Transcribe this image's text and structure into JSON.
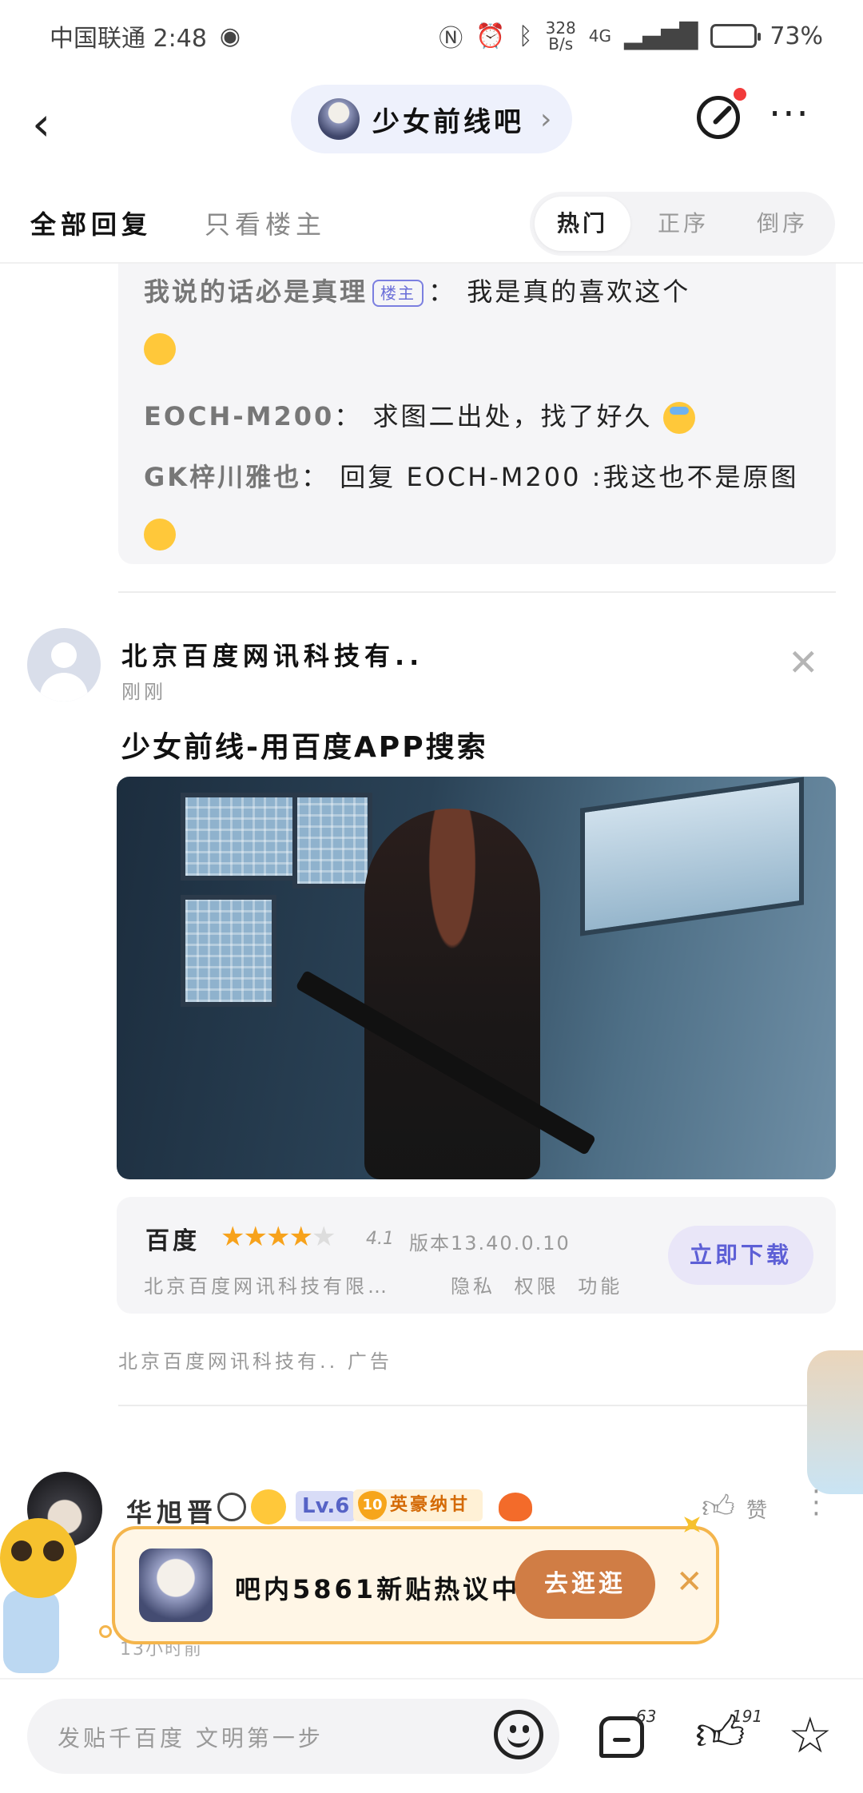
{
  "status_bar": {
    "carrier_time": "中国联通 2:48",
    "speed_value": "328",
    "speed_unit": "B/s",
    "network": "4G",
    "battery_percent": "73%",
    "battery_level": 0.73
  },
  "top_nav": {
    "forum_name": "少女前线吧"
  },
  "filter": {
    "tab_all": "全部回复",
    "tab_op_only": "只看楼主",
    "sort_hot": "热门",
    "sort_asc": "正序",
    "sort_desc": "倒序"
  },
  "sub_replies": [
    {
      "user": "我说的话必是真理",
      "tag": "楼主",
      "sep": "：",
      "text": "我是真的喜欢这个"
    },
    {
      "user": "EOCH-M200",
      "sep": "：",
      "text": "求图二出处，找了好久"
    },
    {
      "user": "GK梓川雅也",
      "sep": "：",
      "text": "回复 EOCH-M200 :我这也不是原图"
    }
  ],
  "ad": {
    "advertiser": "北京百度网讯科技有..",
    "time": "刚刚",
    "title": "少女前线-用百度APP搜索",
    "app_name": "百度",
    "rating": "4.1",
    "rating_value": 4.1,
    "version": "版本13.40.0.10",
    "developer": "北京百度网讯科技有限…",
    "links": [
      "隐私",
      "权限",
      "功能"
    ],
    "download_label": "立即下载",
    "footer": "北京百度网讯科技有.. 广告"
  },
  "next_reply": {
    "user": "华旭晋",
    "level": "Lv.6",
    "honor_level": "10",
    "honor_title": "英豪纳甘",
    "like_label": "赞",
    "time": "13小时前"
  },
  "banner": {
    "text": "吧内5861新贴热议中",
    "button": "去逛逛"
  },
  "bottom_bar": {
    "input_placeholder": "发贴千百度 文明第一步",
    "comment_count": "63",
    "like_count": "191"
  }
}
